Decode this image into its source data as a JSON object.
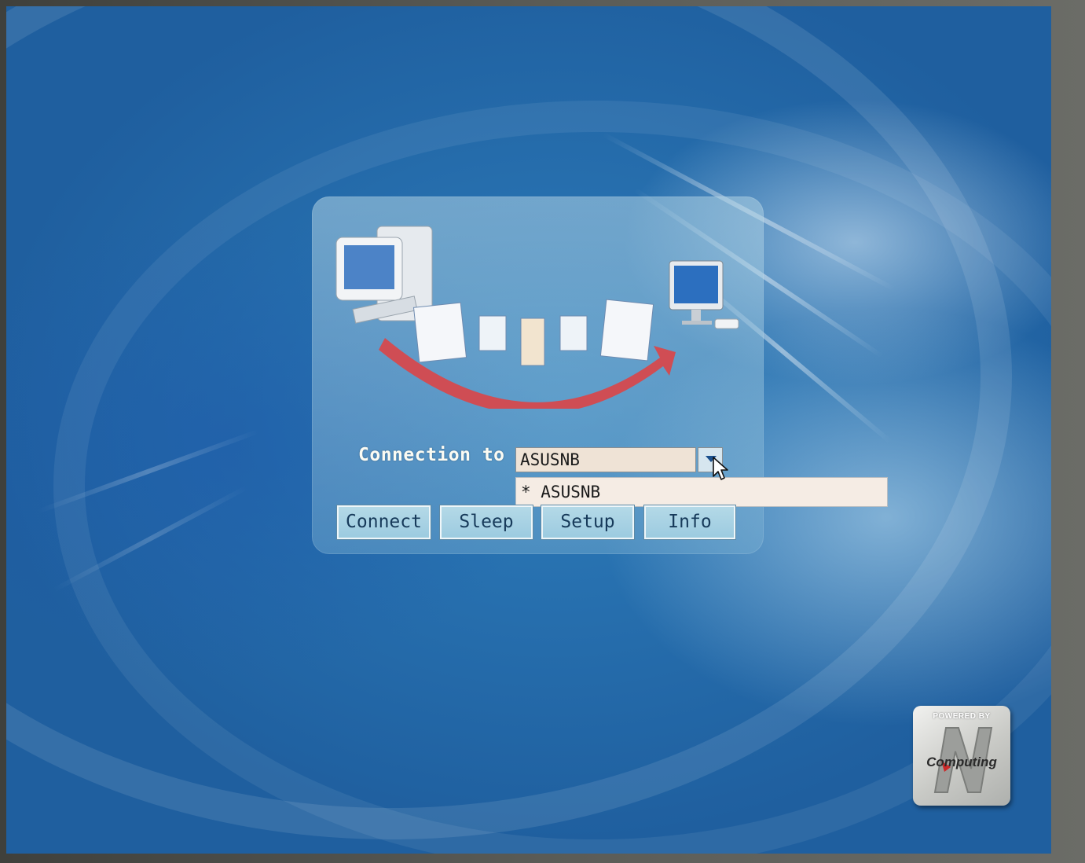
{
  "connection": {
    "label": "Connection to",
    "selected_value": "ASUSNB",
    "dropdown_options": [
      "* ASUSNB"
    ]
  },
  "buttons": {
    "connect": "Connect",
    "sleep": "Sleep",
    "setup": "Setup",
    "info": "Info"
  },
  "logo": {
    "top_text": "POWERED BY",
    "brand_text": "Computing"
  },
  "icons": {
    "hero": "remote-desktop-illustration",
    "dropdown_arrow": "chevron-down-icon",
    "cursor": "mouse-pointer-icon"
  },
  "colors": {
    "background": "#2d7dbb",
    "button_face": "#a8d2e4",
    "field_bg": "#efe3d6",
    "label_text": "#fbfbf3",
    "hero_arrow": "#d9464a"
  }
}
